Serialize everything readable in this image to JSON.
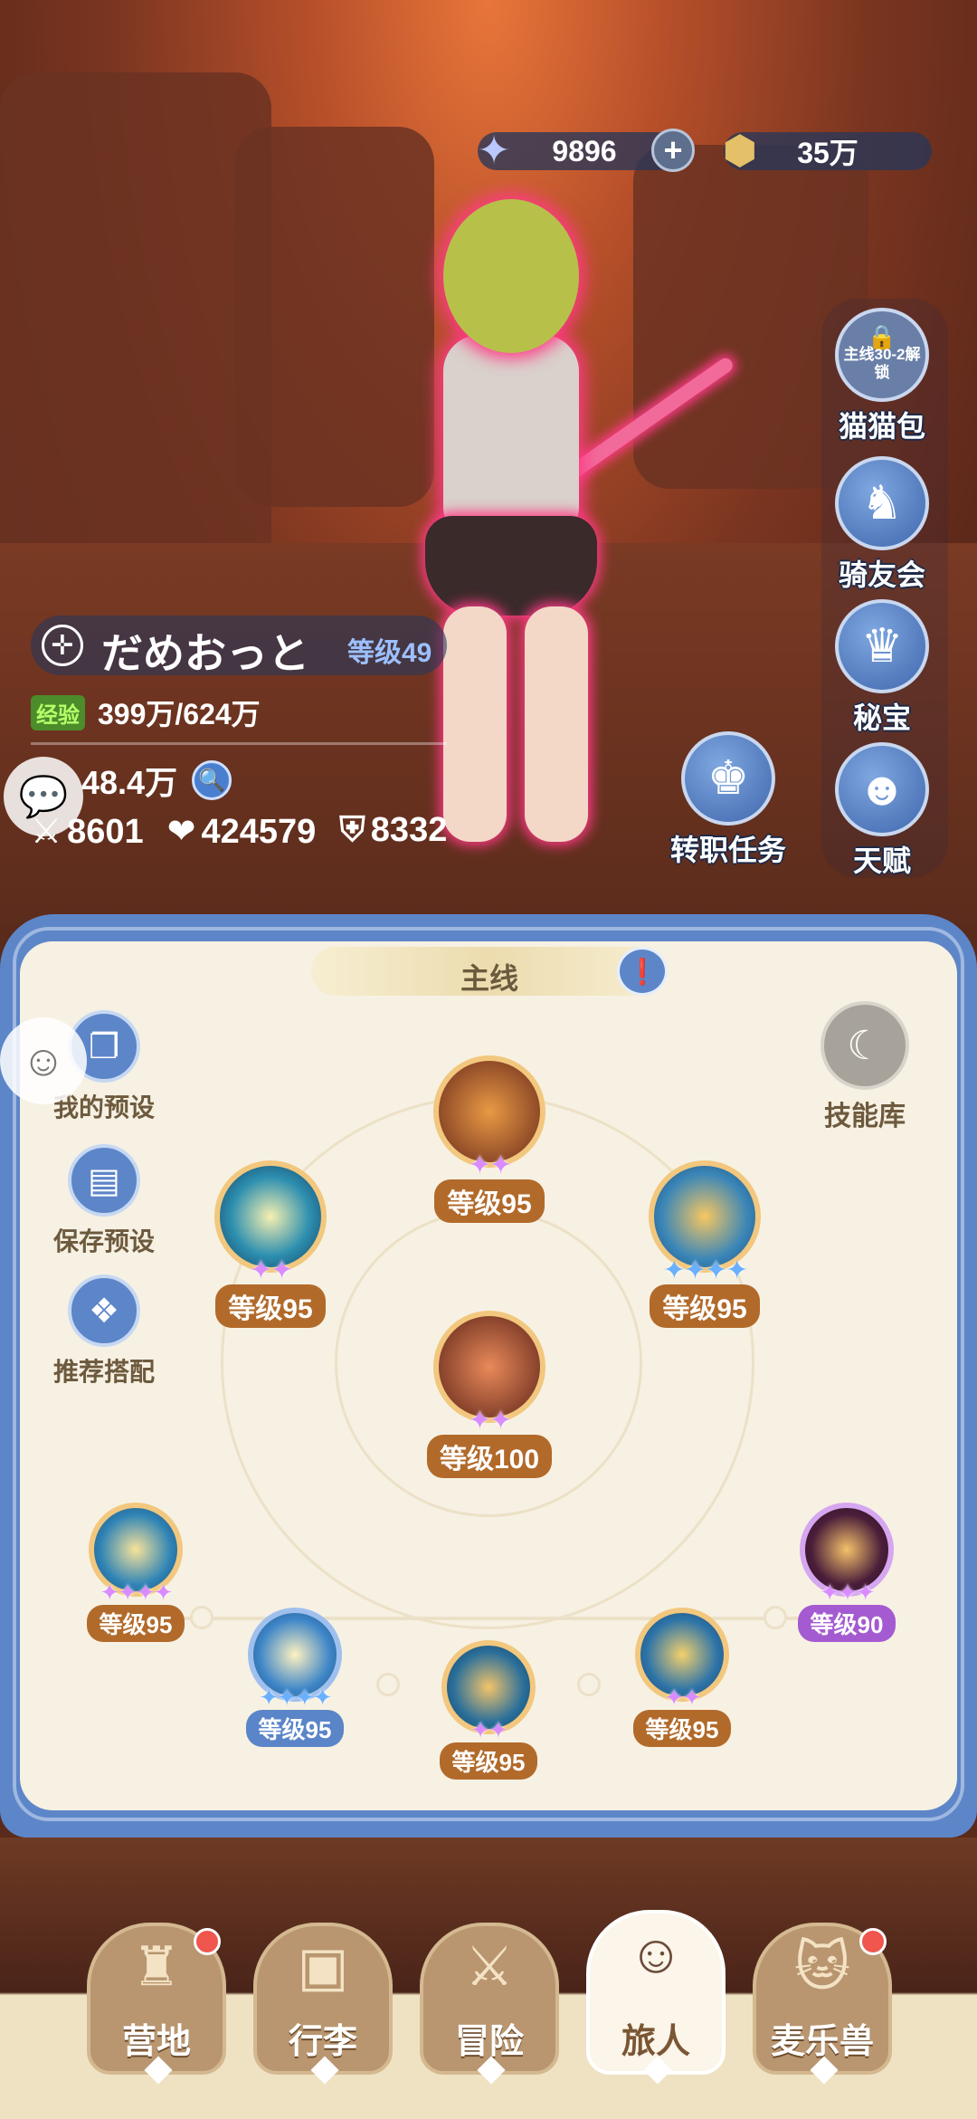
{
  "currency": {
    "gems": "9896",
    "gold": "35万"
  },
  "side_buttons": [
    {
      "name": "猫猫包",
      "note": "主线30-2解锁"
    },
    {
      "name": "骑友会"
    },
    {
      "name": "秘宝"
    },
    {
      "name": "天赋"
    }
  ],
  "job_task": "转职任务",
  "player": {
    "name": "だめおっと",
    "level": "等级49",
    "exp_label": "经验",
    "exp": "399万/624万",
    "power": "48.4万",
    "attack": "8601",
    "hp": "424579",
    "defense": "8332"
  },
  "panel": {
    "tab": "主线",
    "left_buttons": [
      "我的预设",
      "保存预设",
      "推荐搭配"
    ],
    "skill_library": "技能库"
  },
  "skills": {
    "top": "等级95",
    "upper_left": "等级95",
    "upper_right": "等级95",
    "center": "等级100",
    "bottom_far_left": "等级95",
    "bottom_left": "等级95",
    "bottom_center": "等级95",
    "bottom_right": "等级95",
    "bottom_far_right": "等级90"
  },
  "nav": [
    "营地",
    "行李",
    "冒险",
    "旅人",
    "麦乐兽"
  ],
  "colors": {
    "panel_blue": "#5d86c9",
    "panel_cream": "#f7f1e3",
    "level_brown": "#b26a2a",
    "level_purple": "#a45ad1",
    "nav_dot": "#f0554e"
  }
}
